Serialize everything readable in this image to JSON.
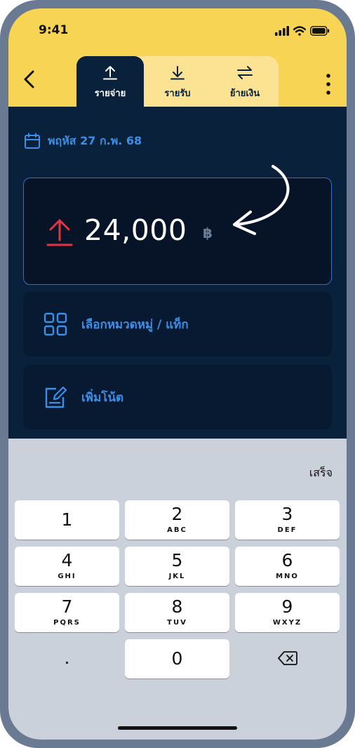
{
  "status_bar": {
    "time": "9:41"
  },
  "tabs": [
    {
      "label": "รายจ่าย",
      "icon": "upload-icon",
      "active": true
    },
    {
      "label": "รายรับ",
      "icon": "download-icon",
      "active": false
    },
    {
      "label": "ย้ายเงิน",
      "icon": "transfer-icon",
      "active": false
    }
  ],
  "date": {
    "label": "พฤหัส 27 ก.พ. 68"
  },
  "amount": {
    "value": "24,000",
    "currency": "฿"
  },
  "options": {
    "category": "เลือกหมวดหมู่ / แท็ก",
    "note": "เพิ่มโน้ต"
  },
  "keyboard": {
    "done": "เสร็จ",
    "keys": [
      {
        "digit": "1",
        "letters": ""
      },
      {
        "digit": "2",
        "letters": "ABC"
      },
      {
        "digit": "3",
        "letters": "DEF"
      },
      {
        "digit": "4",
        "letters": "GHI"
      },
      {
        "digit": "5",
        "letters": "JKL"
      },
      {
        "digit": "6",
        "letters": "MNO"
      },
      {
        "digit": "7",
        "letters": "PQRS"
      },
      {
        "digit": "8",
        "letters": "TUV"
      },
      {
        "digit": "9",
        "letters": "WXYZ"
      },
      {
        "digit": ".",
        "letters": ""
      },
      {
        "digit": "0",
        "letters": ""
      }
    ]
  },
  "colors": {
    "header": "#f7d454",
    "background": "#0a213b",
    "accent": "#3d8ee6",
    "expense": "#e8333f"
  }
}
